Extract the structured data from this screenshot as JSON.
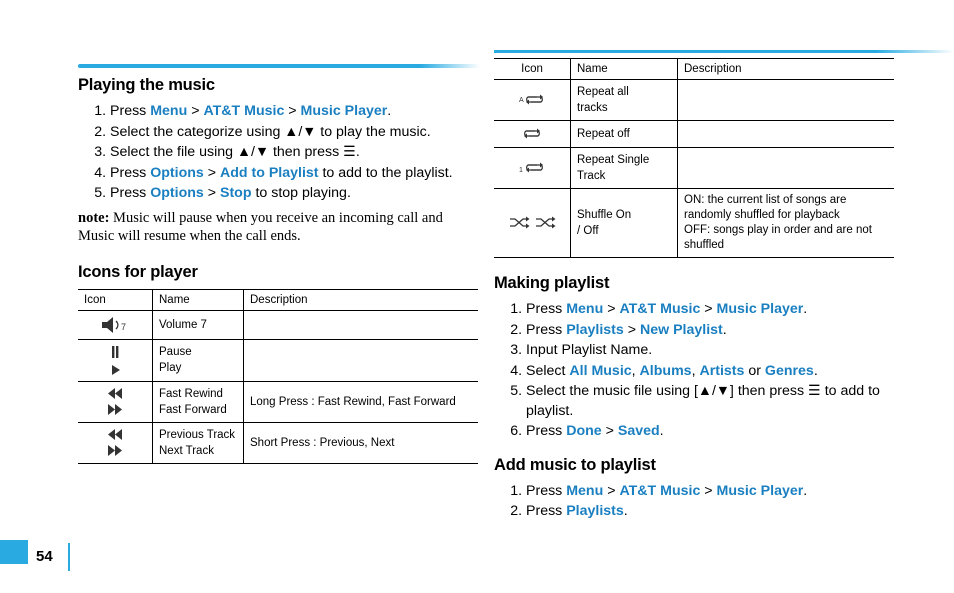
{
  "page_number": "54",
  "left": {
    "section1": {
      "title": "Playing the music",
      "steps": [
        {
          "parts": [
            {
              "t": "Press ",
              "b": false
            },
            {
              "t": "Menu",
              "b": true
            },
            {
              "t": " > ",
              "b": false
            },
            {
              "t": "AT&T Music",
              "b": true
            },
            {
              "t": " > ",
              "b": false
            },
            {
              "t": "Music Player",
              "b": true
            },
            {
              "t": ".",
              "b": false
            }
          ]
        },
        {
          "parts": [
            {
              "t": "Select the categorize using ▲/▼ to play the music.",
              "b": false
            }
          ]
        },
        {
          "parts": [
            {
              "t": "Select the file using ▲/▼ then press ",
              "b": false
            },
            {
              "t": "☰",
              "b": false
            },
            {
              "t": ".",
              "b": false
            }
          ]
        },
        {
          "parts": [
            {
              "t": "Press ",
              "b": false
            },
            {
              "t": "Options",
              "b": true
            },
            {
              "t": " > ",
              "b": false
            },
            {
              "t": "Add to Playlist",
              "b": true
            },
            {
              "t": " to add to the playlist.",
              "b": false
            }
          ]
        },
        {
          "parts": [
            {
              "t": "Press ",
              "b": false
            },
            {
              "t": "Options",
              "b": true
            },
            {
              "t": " > ",
              "b": false
            },
            {
              "t": "Stop",
              "b": true
            },
            {
              "t": " to stop playing.",
              "b": false
            }
          ]
        }
      ],
      "note_label": "note:",
      "note_text": " Music will pause when you receive an incoming call and Music will resume when the call ends."
    },
    "section2": {
      "title": "Icons for player",
      "table": {
        "headers": [
          "Icon",
          "Name",
          "Description"
        ],
        "rows": [
          {
            "icon": "volume-icon",
            "name": [
              "Volume 7"
            ],
            "desc": ""
          },
          {
            "icon": "pause-play-icon",
            "name": [
              "Pause",
              "Play"
            ],
            "desc": ""
          },
          {
            "icon": "rewind-forward-icon",
            "name": [
              "Fast Rewind",
              "Fast Forward"
            ],
            "desc": "Long Press : Fast Rewind, Fast Forward"
          },
          {
            "icon": "prev-next-track-icon",
            "name": [
              "Previous Track",
              "Next Track"
            ],
            "desc": "Short Press : Previous, Next"
          }
        ]
      }
    }
  },
  "right": {
    "table": {
      "headers": [
        "Icon",
        "Name",
        "Description"
      ],
      "rows": [
        {
          "icon": "repeat-all-icon",
          "name": [
            "Repeat all",
            "tracks"
          ],
          "desc": ""
        },
        {
          "icon": "repeat-off-icon",
          "name": [
            "Repeat off"
          ],
          "desc": ""
        },
        {
          "icon": "repeat-single-icon",
          "name": [
            "Repeat Single",
            "Track"
          ],
          "desc": ""
        },
        {
          "icon": "shuffle-icon",
          "name": [
            "Shuffle On",
            "/ Off"
          ],
          "desc": "ON: the current list of songs are randomly shuffled for playback\nOFF: songs play in order and are not shuffled"
        }
      ]
    },
    "section1": {
      "title": "Making playlist",
      "steps": [
        {
          "parts": [
            {
              "t": "Press ",
              "b": false
            },
            {
              "t": "Menu",
              "b": true
            },
            {
              "t": " > ",
              "b": false
            },
            {
              "t": "AT&T Music",
              "b": true
            },
            {
              "t": " > ",
              "b": false
            },
            {
              "t": "Music Player",
              "b": true
            },
            {
              "t": ".",
              "b": false
            }
          ]
        },
        {
          "parts": [
            {
              "t": "Press ",
              "b": false
            },
            {
              "t": "Playlists",
              "b": true
            },
            {
              "t": " > ",
              "b": false
            },
            {
              "t": "New Playlist",
              "b": true
            },
            {
              "t": ".",
              "b": false
            }
          ]
        },
        {
          "parts": [
            {
              "t": "Input Playlist Name.",
              "b": false
            }
          ]
        },
        {
          "parts": [
            {
              "t": "Select ",
              "b": false
            },
            {
              "t": "All Music",
              "b": true
            },
            {
              "t": ", ",
              "b": false
            },
            {
              "t": "Albums",
              "b": true
            },
            {
              "t": ", ",
              "b": false
            },
            {
              "t": "Artists",
              "b": true
            },
            {
              "t": " or ",
              "b": false
            },
            {
              "t": "Genres",
              "b": true
            },
            {
              "t": ".",
              "b": false
            }
          ]
        },
        {
          "parts": [
            {
              "t": "Select the music file using [▲/▼] then press ",
              "b": false
            },
            {
              "t": "☰",
              "b": false
            },
            {
              "t": " to add to playlist.",
              "b": false
            }
          ]
        },
        {
          "parts": [
            {
              "t": "Press ",
              "b": false
            },
            {
              "t": "Done",
              "b": true
            },
            {
              "t": " > ",
              "b": false
            },
            {
              "t": "Saved",
              "b": true
            },
            {
              "t": ".",
              "b": false
            }
          ]
        }
      ]
    },
    "section2": {
      "title": "Add music to playlist",
      "steps": [
        {
          "parts": [
            {
              "t": "Press ",
              "b": false
            },
            {
              "t": "Menu",
              "b": true
            },
            {
              "t": " > ",
              "b": false
            },
            {
              "t": "AT&T Music",
              "b": true
            },
            {
              "t": " > ",
              "b": false
            },
            {
              "t": "Music Player",
              "b": true
            },
            {
              "t": ".",
              "b": false
            }
          ]
        },
        {
          "parts": [
            {
              "t": "Press ",
              "b": false
            },
            {
              "t": "Playlists",
              "b": true
            },
            {
              "t": ".",
              "b": false
            }
          ]
        }
      ]
    }
  }
}
